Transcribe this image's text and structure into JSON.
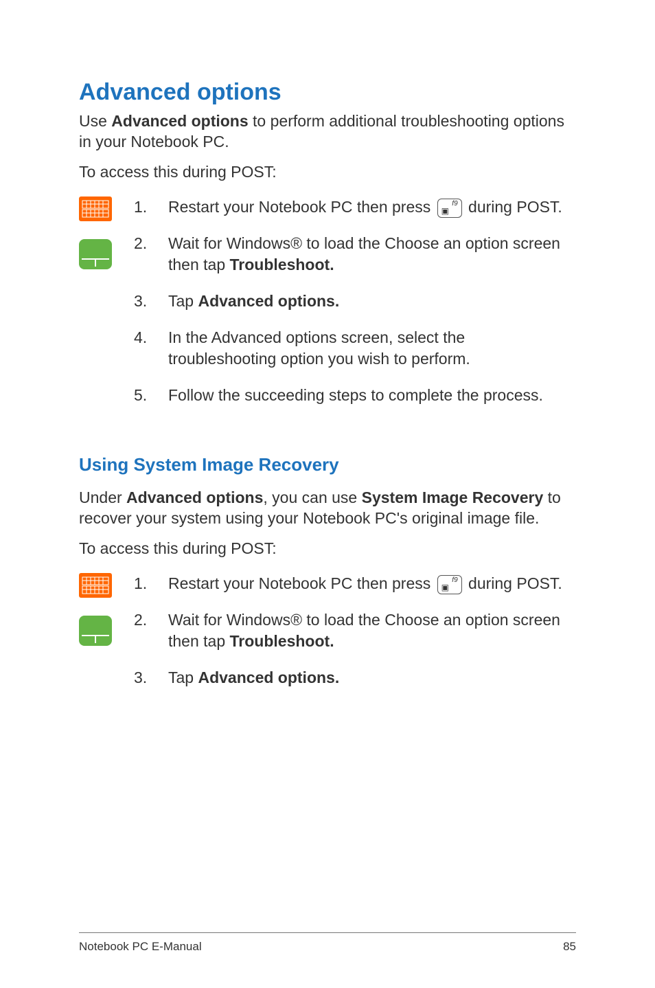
{
  "title": "Advanced options",
  "intro_pre": "Use ",
  "intro_bold": "Advanced options",
  "intro_post": " to perform additional troubleshooting options in your Notebook PC.",
  "access_line": "To access this during POST:",
  "steps1": {
    "s1_pre": "Restart your Notebook PC then press ",
    "s1_post": " during POST.",
    "s2_pre": "Wait for Windows® to load the Choose an option screen then tap ",
    "s2_bold": "Troubleshoot.",
    "s3_pre": "Tap ",
    "s3_bold": "Advanced options.",
    "s4": "In the Advanced options screen, select the troubleshooting option you wish to perform.",
    "s5": "Follow the succeeding steps to complete the process."
  },
  "sub_title": "Using System Image Recovery",
  "sub_intro_pre": "Under ",
  "sub_intro_bold1": "Advanced options",
  "sub_intro_mid": ", you can use ",
  "sub_intro_bold2": "System Image Recovery",
  "sub_intro_post": " to recover your system using your Notebook PC's original image file.",
  "access_line2": "To access this during POST:",
  "steps2": {
    "s1_pre": "Restart your Notebook PC then press ",
    "s1_post": " during POST.",
    "s2_pre": "Wait for Windows® to load the Choose an option screen then tap ",
    "s2_bold": "Troubleshoot.",
    "s3_pre": "Tap ",
    "s3_bold": "Advanced options."
  },
  "key_label": "f9",
  "footer_left": "Notebook PC E-Manual",
  "footer_right": "85"
}
